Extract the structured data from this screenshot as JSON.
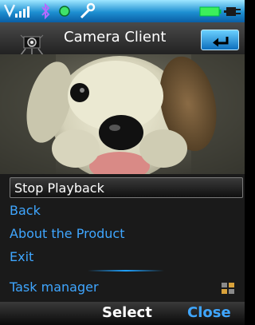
{
  "app": {
    "title": "Camera Client"
  },
  "status_bar": {
    "icons": [
      "signal-icon",
      "bluetooth-icon",
      "dot-icon",
      "wrench-icon",
      "battery-icon",
      "plug-icon"
    ]
  },
  "menu": {
    "items": [
      {
        "label": "Stop Playback",
        "selected": true
      },
      {
        "label": "Back"
      },
      {
        "label": "About the Product"
      },
      {
        "label": "Exit"
      },
      {
        "label": "Task manager"
      }
    ]
  },
  "softkeys": {
    "select": "Select",
    "close": "Close"
  },
  "colors": {
    "accent": "#3fa6ff",
    "status_bar": "#1d8fd1",
    "background": "#1a1a1a"
  }
}
